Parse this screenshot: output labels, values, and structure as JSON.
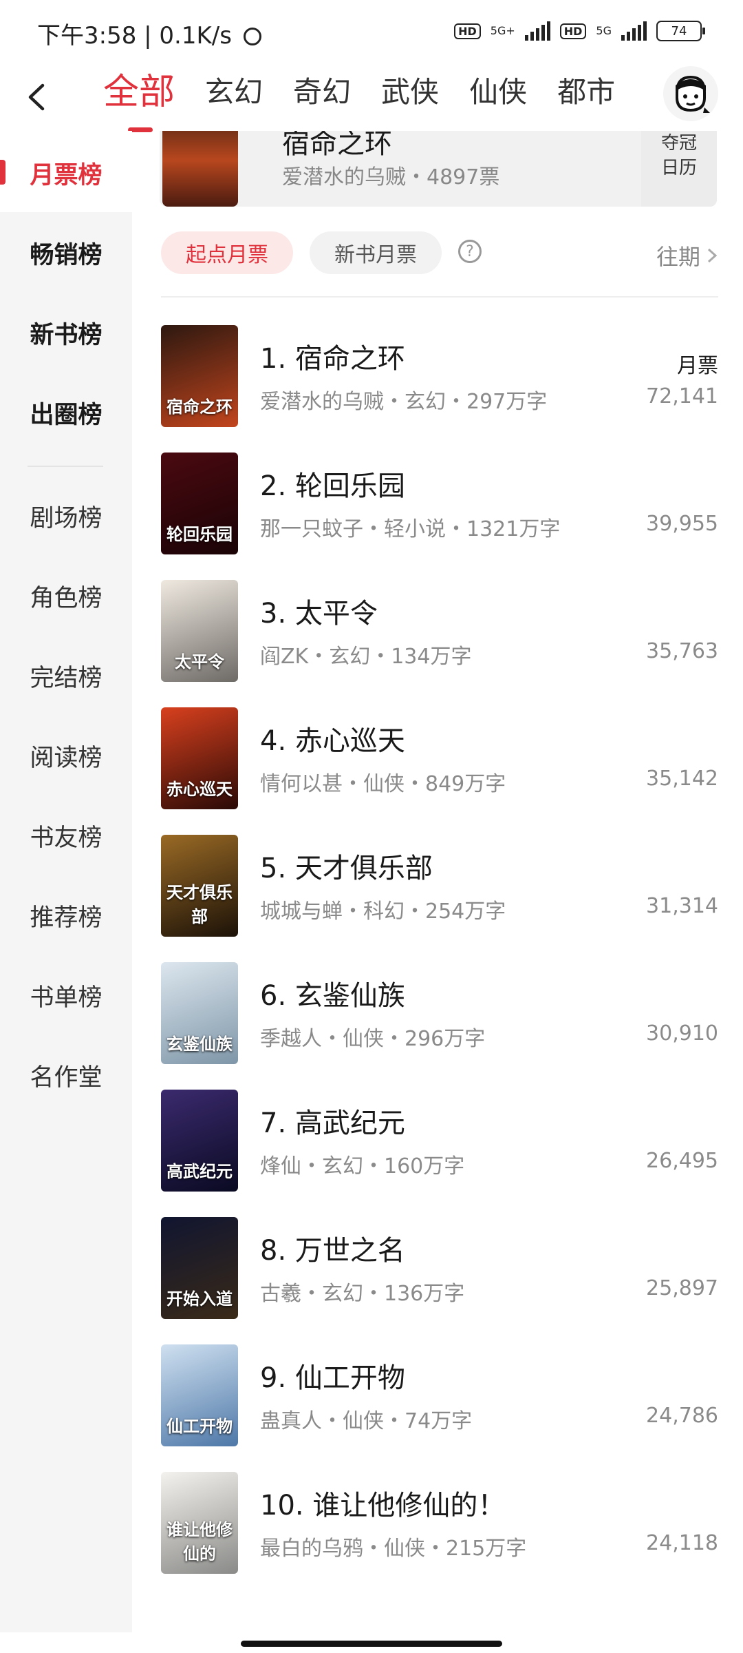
{
  "status_bar": {
    "left": "下午3:58 | 0.1K/s",
    "net1": "5G+",
    "net2": "5G",
    "hd": "HD",
    "battery": "74"
  },
  "nav": {
    "tabs": [
      "全部",
      "玄幻",
      "奇幻",
      "武侠",
      "仙侠",
      "都市"
    ]
  },
  "sidebar": {
    "items": [
      "月票榜",
      "畅销榜",
      "新书榜",
      "出圈榜",
      "剧场榜",
      "角色榜",
      "完结榜",
      "阅读榜",
      "书友榜",
      "推荐榜",
      "书单榜",
      "名作堂"
    ]
  },
  "banner": {
    "title": "宿命之环",
    "subtitle": "爱潜水的乌贼・4897票",
    "side_line1": "夺冠",
    "side_line2": "日历"
  },
  "filters": {
    "chip_active": "起点月票",
    "chip_other": "新书月票",
    "help": "?",
    "past": "往期"
  },
  "list": {
    "ticket_label": "月票",
    "books": [
      {
        "title": "1. 宿命之环",
        "meta": "爱潜水的乌贼・玄幻・297万字",
        "count": "72,141",
        "cover_text": "宿命之环",
        "c1": "#2d1810",
        "c2": "#c2451d"
      },
      {
        "title": "2. 轮回乐园",
        "meta": "那一只蚊子・轻小说・1321万字",
        "count": "39,955",
        "cover_text": "轮回乐园",
        "c1": "#4a0a10",
        "c2": "#1a0306"
      },
      {
        "title": "3. 太平令",
        "meta": "阎ZK・玄幻・134万字",
        "count": "35,763",
        "cover_text": "太平令",
        "c1": "#efe9e0",
        "c2": "#6e6a66"
      },
      {
        "title": "4. 赤心巡天",
        "meta": "情何以甚・仙侠・849万字",
        "count": "35,142",
        "cover_text": "赤心巡天",
        "c1": "#d8401e",
        "c2": "#2a0a06"
      },
      {
        "title": "5. 天才俱乐部",
        "meta": "城城与蝉・科幻・254万字",
        "count": "31,314",
        "cover_text": "天才俱乐部",
        "c1": "#9a6a25",
        "c2": "#1c1208"
      },
      {
        "title": "6. 玄鉴仙族",
        "meta": "季越人・仙侠・296万字",
        "count": "30,910",
        "cover_text": "玄鉴仙族",
        "c1": "#dce6ee",
        "c2": "#7e96a8"
      },
      {
        "title": "7. 高武纪元",
        "meta": "烽仙・玄幻・160万字",
        "count": "26,495",
        "cover_text": "高武纪元",
        "c1": "#3b2a6e",
        "c2": "#0a0a22"
      },
      {
        "title": "8. 万世之名",
        "meta": "古羲・玄幻・136万字",
        "count": "25,897",
        "cover_text": "开始入道",
        "c1": "#101530",
        "c2": "#3a2a18"
      },
      {
        "title": "9. 仙工开物",
        "meta": "蛊真人・仙侠・74万字",
        "count": "24,786",
        "cover_text": "仙工开物",
        "c1": "#cfe0f0",
        "c2": "#4e78a8"
      },
      {
        "title": "10. 谁让他修仙的！",
        "meta": "最白的乌鸦・仙侠・215万字",
        "count": "24,118",
        "cover_text": "谁让他修仙的",
        "c1": "#f4f2ee",
        "c2": "#8a8a88"
      }
    ]
  }
}
